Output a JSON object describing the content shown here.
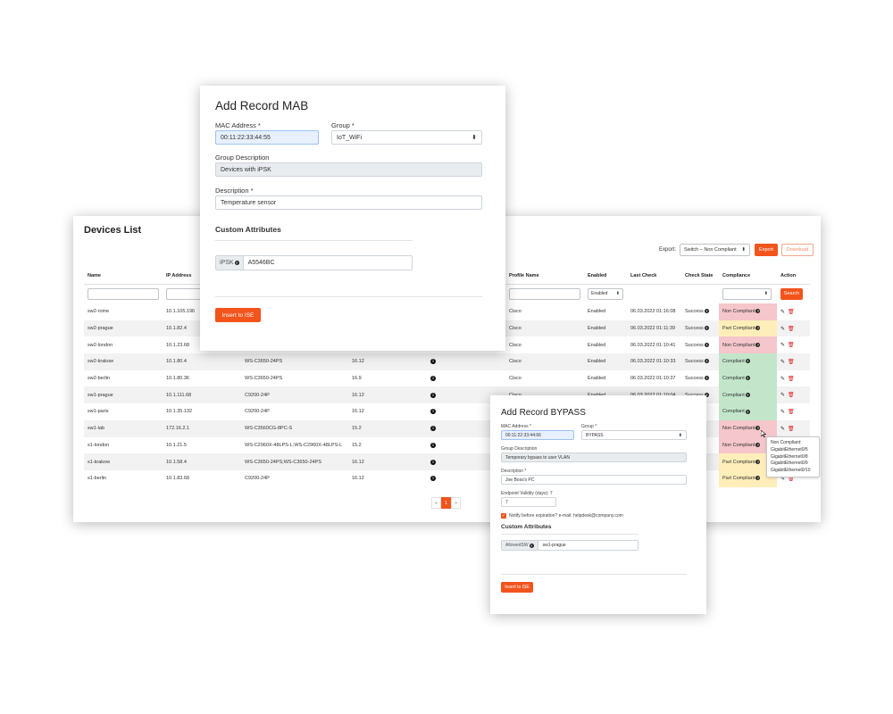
{
  "devices_list": {
    "title": "Devices List",
    "export_label": "Export:",
    "export_option": "Switch – Non Compliant",
    "export_button": "Export",
    "download_button": "Download",
    "columns": [
      "Name",
      "IP Address",
      "",
      "",
      "",
      "Profile Name",
      "Enabled",
      "Last Check",
      "Check State",
      "Compliance",
      "Action"
    ],
    "filter_enabled": "Enabled",
    "search_button": "Search",
    "rows": [
      {
        "name": "sw2-rome",
        "ip": "10.1.105.196",
        "model": "",
        "version": "",
        "profile": "Cisco",
        "enabled": "Enabled",
        "last_check": "06.03.2022 01:16:08",
        "state": "Success",
        "compliance": "Non Compliant",
        "ctype": "non"
      },
      {
        "name": "sw2-prague",
        "ip": "10.1.82.4",
        "model": "",
        "version": "",
        "profile": "Cisco",
        "enabled": "Enabled",
        "last_check": "06.03.2022 01:11:39",
        "state": "Success",
        "compliance": "Part Compliant",
        "ctype": "part"
      },
      {
        "name": "sw2-london",
        "ip": "10.1.23.68",
        "model": "",
        "version": "",
        "profile": "Cisco",
        "enabled": "Enabled",
        "last_check": "06.03.2022 01:10:41",
        "state": "Success",
        "compliance": "Non Compliant",
        "ctype": "non"
      },
      {
        "name": "sw2-krakow",
        "ip": "10.1.80.4",
        "model": "WS-C3650-24PS",
        "version": "16.12",
        "profile": "Cisco",
        "enabled": "Enabled",
        "last_check": "06.03.2022 01:10:33",
        "state": "Success",
        "compliance": "Compliant",
        "ctype": "ok"
      },
      {
        "name": "sw2-berlin",
        "ip": "10.1.80.36",
        "model": "WS-C3650-24PS",
        "version": "16.9",
        "profile": "Cisco",
        "enabled": "Enabled",
        "last_check": "06.03.2022 01:10:37",
        "state": "Success",
        "compliance": "Compliant",
        "ctype": "ok"
      },
      {
        "name": "sw1-prague",
        "ip": "10.1.111.68",
        "model": "C9200-24P",
        "version": "16.12",
        "profile": "Cisco",
        "enabled": "Enabled",
        "last_check": "06.03.2022 01:10:04",
        "state": "Success",
        "compliance": "Compliant",
        "ctype": "ok"
      },
      {
        "name": "sw1-paris",
        "ip": "10.1.35.132",
        "model": "C9200-24P",
        "version": "16.12",
        "profile": "",
        "enabled": "",
        "last_check": "",
        "state": "",
        "compliance": "Compliant",
        "ctype": "ok"
      },
      {
        "name": "sw1-lab",
        "ip": "172.16.2.1",
        "model": "WS-C3560CG-8PC-S",
        "version": "15.2",
        "profile": "",
        "enabled": "",
        "last_check": "",
        "state": "",
        "compliance": "Non Compliant",
        "ctype": "non"
      },
      {
        "name": "s1-london",
        "ip": "10.1.21.5",
        "model": "WS-C2960X-48LPS-L;WS-C2960X-48LPS-L",
        "version": "15.2",
        "profile": "",
        "enabled": "",
        "last_check": "",
        "state": "",
        "compliance": "Non Compliant",
        "ctype": "non"
      },
      {
        "name": "s1-krakow",
        "ip": "10.1.58.4",
        "model": "WS-C3650-24PS;WS-C3650-24PS",
        "version": "16.12",
        "profile": "",
        "enabled": "",
        "last_check": "",
        "state": "",
        "compliance": "Part Compliant",
        "ctype": "part"
      },
      {
        "name": "s1-berlin",
        "ip": "10.1.83.68",
        "model": "C9200-24P",
        "version": "16.12",
        "profile": "",
        "enabled": "",
        "last_check": "",
        "state": "",
        "compliance": "Part Compliant",
        "ctype": "part"
      }
    ],
    "pager": {
      "prev": "«",
      "current": "1",
      "next": "»"
    }
  },
  "mab": {
    "title": "Add Record MAB",
    "mac_label": "MAC Address *",
    "mac_value": "00:11:22:33:44:55",
    "group_label": "Group *",
    "group_value": "IoT_WiFi",
    "group_desc_label": "Group Description",
    "group_desc_value": "Devices with iPSK",
    "desc_label": "Description *",
    "desc_value": "Temperature sensor",
    "custom_title": "Custom Attributes",
    "ipsk_label": "iPSK",
    "ipsk_value": "A5546BC",
    "insert_button": "Insert to ISE"
  },
  "bypass": {
    "title": "Add Record BYPASS",
    "mac_label": "MAC Address *",
    "mac_value": "00:11:22:33:44:66",
    "group_label": "Group *",
    "group_value": "BYPASS",
    "group_desc_label": "Group Description",
    "group_desc_value": "Temporary bypass to user VLAN",
    "desc_label": "Description *",
    "desc_value": "Joe Boss's PC",
    "validity_label": "Endpoint Validity (days): 7",
    "validity_value": "7",
    "notify_label": "Notify before expiration? e-mail: helpdesk@company.com",
    "custom_title": "Custom Attributes",
    "allowed_label": "AllowedSW",
    "allowed_value": "sw1-prague",
    "insert_button": "Insert to ISE"
  },
  "tooltip": {
    "lines": [
      "Non Compliant:",
      "GigabitEthernet0/5",
      "GigabitEthernet0/8",
      "GigabitEthernet0/9",
      "GigabitEthernet0/10"
    ]
  },
  "icons": {
    "question": "question-circle-icon",
    "info": "info-circle-icon",
    "edit": "pencil-icon",
    "delete": "trash-icon",
    "dropdown": "caret-updown-icon"
  },
  "colors": {
    "accent": "#f2541c",
    "non_compliant": "#f5c6cb",
    "part_compliant": "#ffeeba",
    "compliant": "#c3e6cb"
  }
}
